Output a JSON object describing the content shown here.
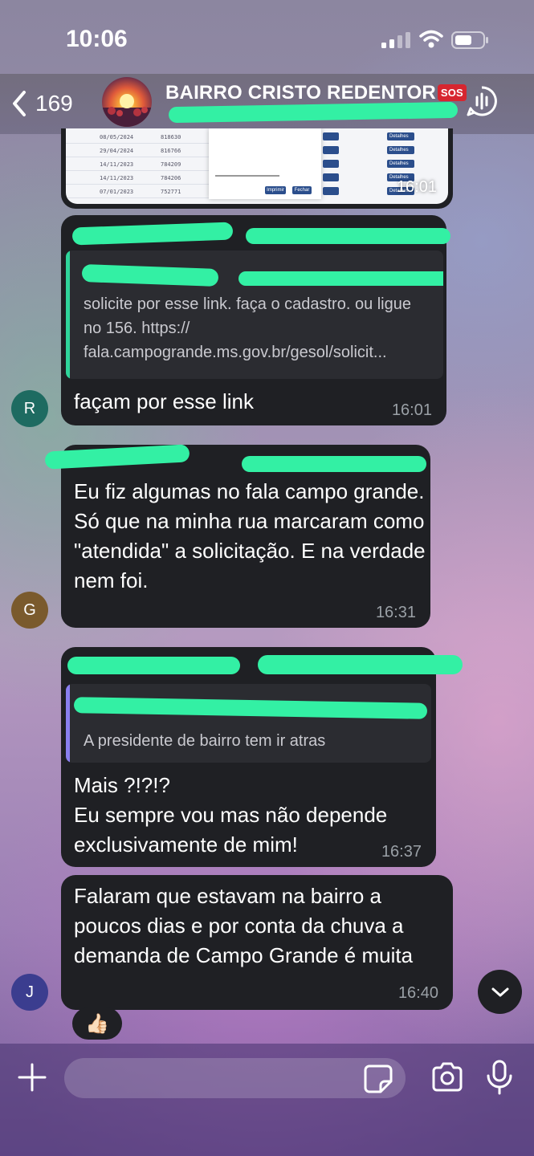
{
  "status_bar": {
    "time": "10:06"
  },
  "header": {
    "back_count": "169",
    "title": "BAIRRO CRISTO REDENTOR",
    "badge": "SOS"
  },
  "image_message": {
    "time": "16:01",
    "rows": [
      {
        "date": "08/05/2024",
        "num": "818630"
      },
      {
        "date": "29/04/2024",
        "num": "816766"
      },
      {
        "date": "14/11/2023",
        "num": "784209"
      },
      {
        "date": "14/11/2023",
        "num": "784206"
      },
      {
        "date": "07/01/2023",
        "num": "752771"
      }
    ],
    "detail_label": "Detalhes",
    "dialog_buttons": [
      "Imprimir",
      "Fechar"
    ]
  },
  "messages": [
    {
      "sender_initial": "R",
      "avatar_color": "#1e6b61",
      "reply_text": "solicite por esse link. faça o cadastro. ou ligue no 156. https:// fala.campogrande.ms.gov.br/gesol/solicit...",
      "reply_color": "#2fd59b",
      "text": "façam por esse link",
      "time": "16:01"
    },
    {
      "sender_initial": "G",
      "avatar_color": "#7a5a2d",
      "text": "Eu fiz algumas no fala campo grande. Só que na minha rua marcaram como \"atendida\" a solicitação. E na verdade nem foi.",
      "time": "16:31"
    },
    {
      "reply_text": "A presidente de bairro tem ir atras",
      "reply_color": "#8a7ff0",
      "text": "Mais ?!?!?\nEu sempre vou mas não depende exclusivamente de mim!",
      "time": "16:37"
    },
    {
      "sender_initial": "J",
      "avatar_color": "#3b3d8f",
      "text": "Falaram que estavam na bairro a poucos dias e por conta da chuva a demanda de Campo Grande é muita",
      "time": "16:40",
      "reaction": "👍🏻"
    }
  ],
  "composer": {
    "placeholder": ""
  },
  "colors": {
    "bubble": "#1f2024",
    "redaction": "#33f0a4",
    "accent_green": "#2fd59b"
  },
  "icons": [
    "back-chevron-icon",
    "signal-icon",
    "wifi-icon",
    "battery-icon",
    "voice-chat-icon",
    "plus-icon",
    "sticker-icon",
    "camera-icon",
    "microphone-icon",
    "chevron-down-icon",
    "thumbs-up-icon"
  ]
}
